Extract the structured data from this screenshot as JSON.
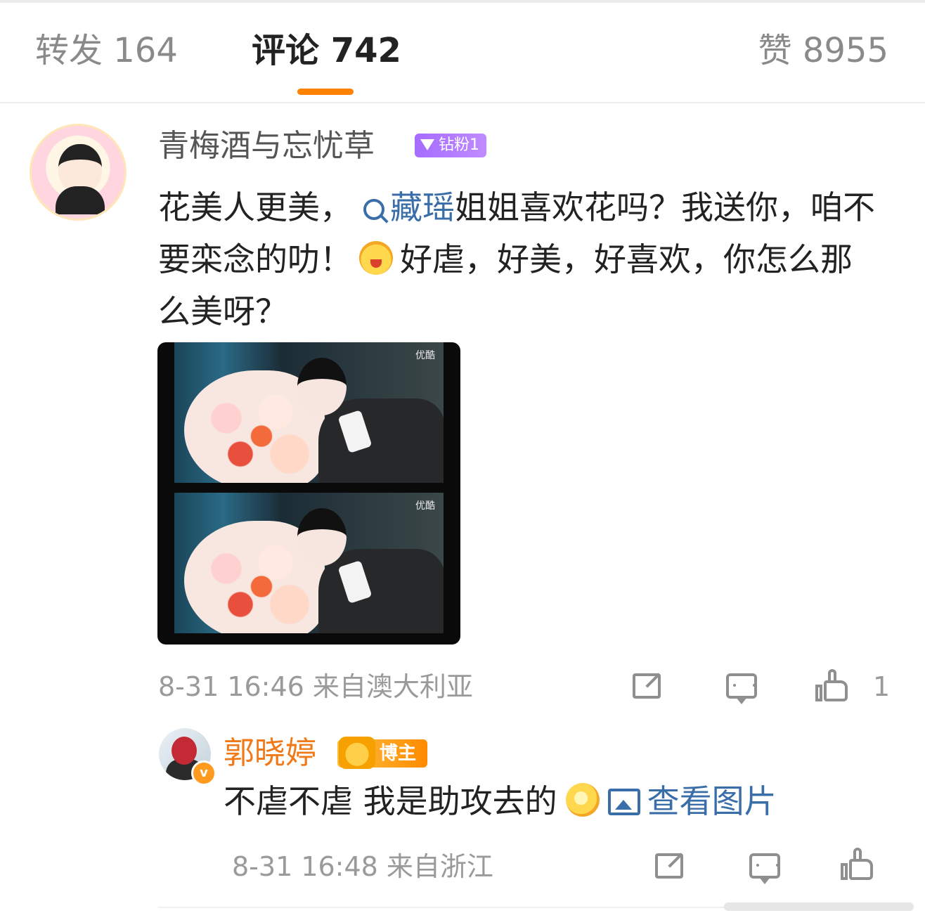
{
  "tabs": {
    "repost": "转发 164",
    "comment": "评论 742",
    "like": "赞 8955",
    "accent_color": "#ff8200"
  },
  "comment": {
    "username": "青梅酒与忘忧草",
    "fan_badge": "钻粉1",
    "text_before_topic": "花美人更美，",
    "topic": "藏瑶",
    "text_after_topic": "姐姐喜欢花吗？我送你，咱不要栾念的叻！",
    "emoji": "happy-emoji",
    "text_after_emoji": "好虐，好美，好喜欢，你怎么那么美呀？",
    "image_watermark": "优酷",
    "time_location": "8-31 16:46 来自澳大利亚",
    "like_count": "1"
  },
  "reply": {
    "username": "郭晓婷",
    "badge": "博主",
    "verified_mark": "v",
    "text": "不虐不虐 我是助攻去的",
    "emoji": "dizzy-emoji",
    "view_image_label": "查看图片",
    "time_location": "8-31 16:48 来自浙江"
  },
  "colors": {
    "link": "#3a6ea8",
    "reply_username": "#f07a19",
    "meta_gray": "#9a9a9a"
  }
}
